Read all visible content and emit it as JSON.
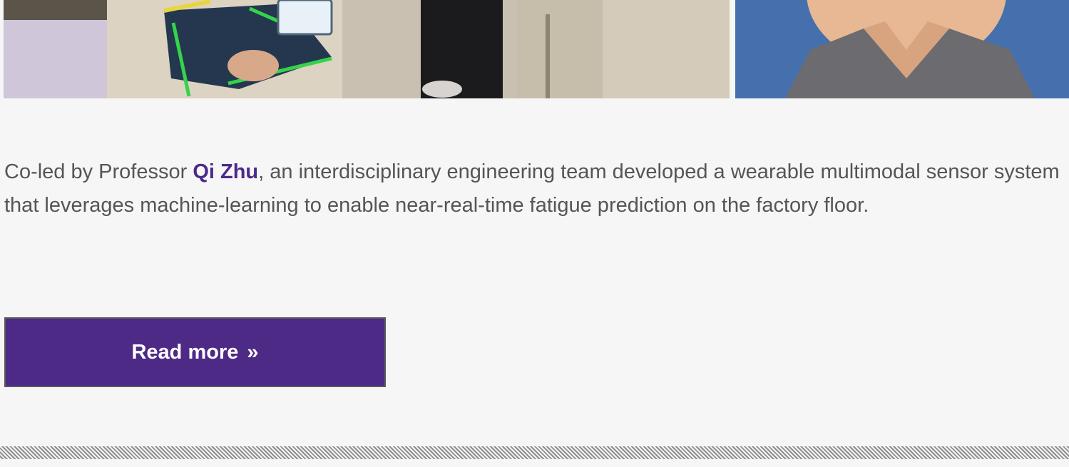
{
  "article": {
    "text_before": "Co-led by Professor ",
    "professor_name": "Qi Zhu",
    "text_after": ", an interdisciplinary engineering team developed a wearable multimodal sensor system that leverages machine-learning to enable near-real-time fatigue prediction on the factory floor."
  },
  "cta": {
    "label": "Read more",
    "arrow": "»"
  },
  "colors": {
    "link": "#4b2a8a",
    "button_bg": "#4e2a87",
    "body_text": "#555555",
    "page_bg": "#f6f6f6"
  },
  "icons": {
    "read_more_arrow": "double-chevron-right-icon"
  }
}
